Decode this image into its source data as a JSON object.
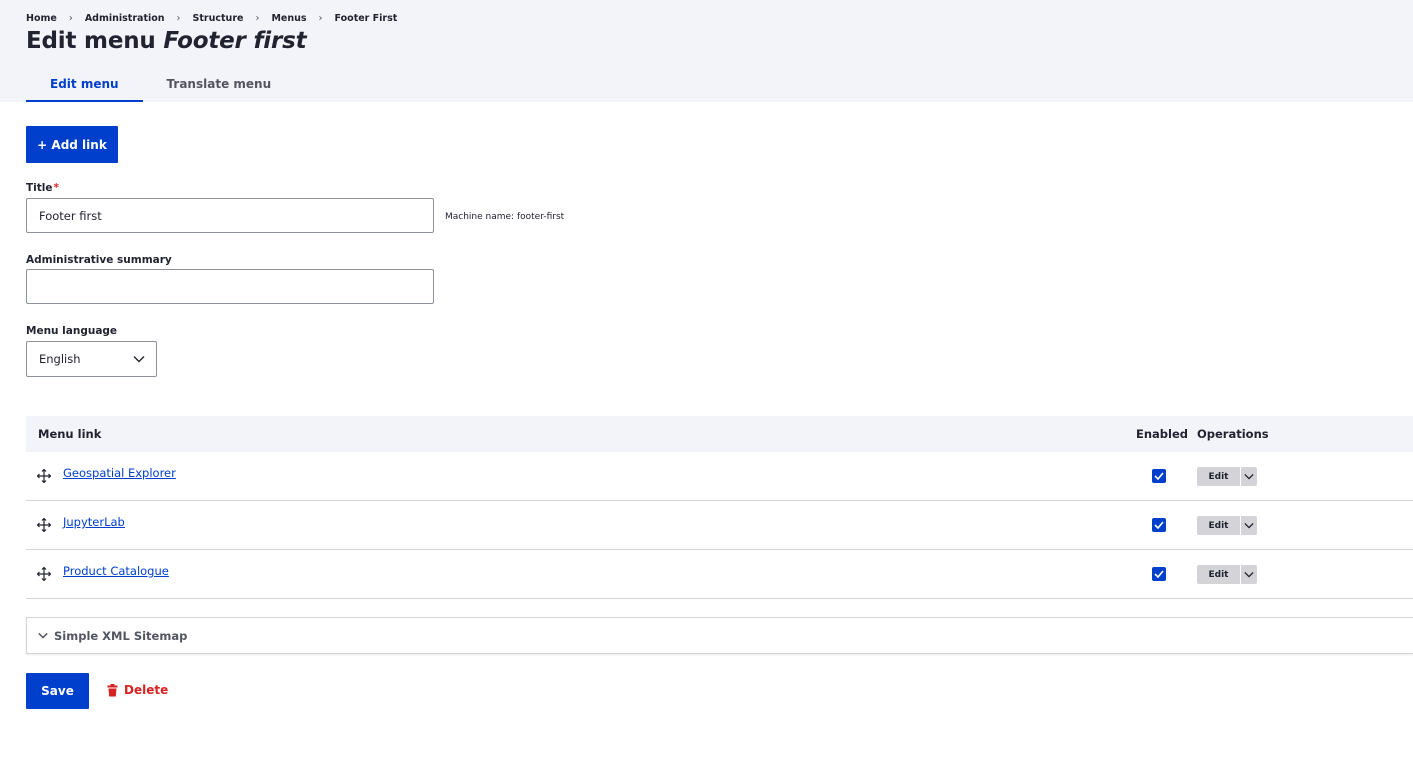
{
  "breadcrumb": [
    "Home",
    "Administration",
    "Structure",
    "Menus",
    "Footer First"
  ],
  "breadcrumb_separator": "›",
  "page_title": {
    "prefix": "Edit menu",
    "name": "Footer first"
  },
  "tabs": [
    {
      "label": "Edit menu",
      "active": true
    },
    {
      "label": "Translate menu",
      "active": false
    }
  ],
  "add_link_button": "+ Add link",
  "title_field": {
    "label": "Title",
    "required_marker": "*",
    "value": "Footer first",
    "machine_name": "Machine name: footer-first"
  },
  "summary_field": {
    "label": "Administrative summary",
    "value": ""
  },
  "language_field": {
    "label": "Menu language",
    "selected": "English"
  },
  "table": {
    "headers": {
      "menu_link": "Menu link",
      "enabled": "Enabled",
      "operations": "Operations"
    },
    "rows": [
      {
        "title": "Geospatial Explorer",
        "enabled": true,
        "operation": "Edit"
      },
      {
        "title": "JupyterLab",
        "enabled": true,
        "operation": "Edit"
      },
      {
        "title": "Product Catalogue",
        "enabled": true,
        "operation": "Edit"
      }
    ]
  },
  "sitemap_details": {
    "label": "Simple XML Sitemap"
  },
  "actions": {
    "save": "Save",
    "delete": "Delete"
  },
  "colors": {
    "accent": "#003ecc",
    "header_bg": "#f3f4f9",
    "danger": "#d72222",
    "text": "#222330"
  }
}
